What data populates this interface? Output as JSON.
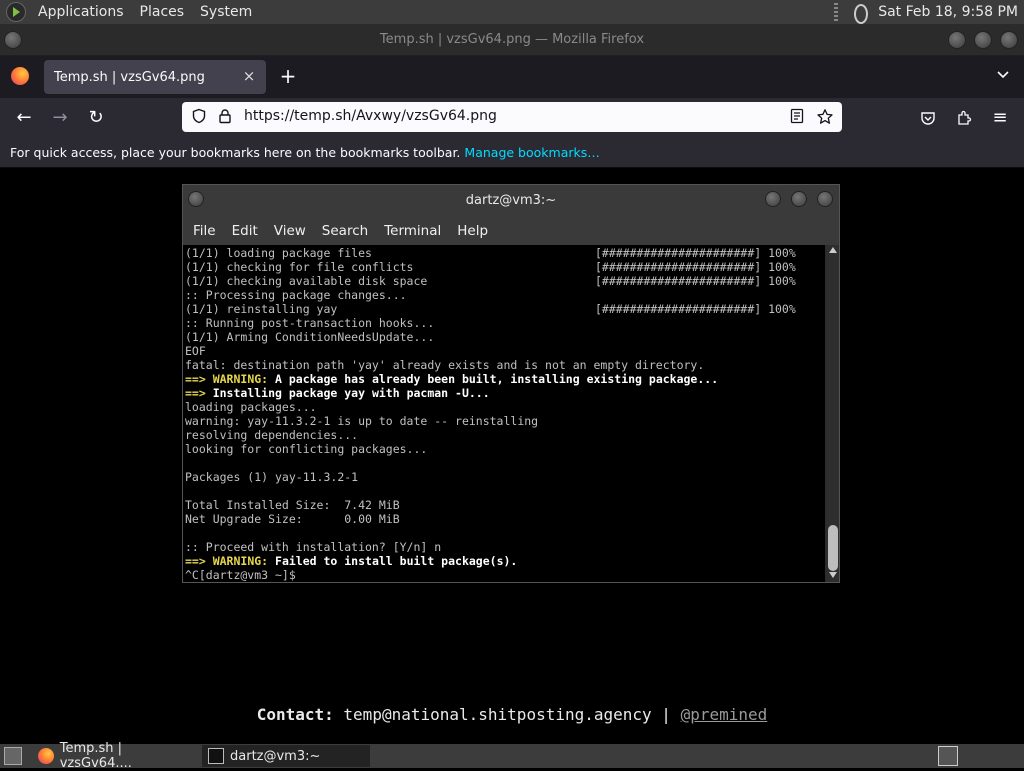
{
  "top_panel": {
    "menus": [
      "Applications",
      "Places",
      "System"
    ],
    "clock": "Sat Feb 18,  9:58 PM"
  },
  "firefox": {
    "window_title": "Temp.sh | vzsGv64.png — Mozilla Firefox",
    "tab_title": "Temp.sh | vzsGv64.png",
    "url": "https://temp.sh/Avxwy/vzsGv64.png",
    "bookmarks_prompt": "For quick access, place your bookmarks here on the bookmarks toolbar.",
    "manage_bookmarks": "Manage bookmarks…"
  },
  "terminal": {
    "title": "dartz@vm3:~",
    "menu": [
      "File",
      "Edit",
      "View",
      "Search",
      "Terminal",
      "Help"
    ],
    "lines": [
      {
        "text": "(1/1) loading package files",
        "progress": "[######################] 100%"
      },
      {
        "text": "(1/1) checking for file conflicts",
        "progress": "[######################] 100%"
      },
      {
        "text": "(1/1) checking available disk space",
        "progress": "[######################] 100%"
      },
      {
        "text": ":: Processing package changes..."
      },
      {
        "text": "(1/1) reinstalling yay",
        "progress": "[######################] 100%"
      },
      {
        "text": ":: Running post-transaction hooks..."
      },
      {
        "text": "(1/1) Arming ConditionNeedsUpdate..."
      },
      {
        "text": "EOF"
      },
      {
        "text": "fatal: destination path 'yay' already exists and is not an empty directory."
      },
      {
        "arrow": "==> ",
        "warn": "WARNING:",
        "bold": " A package has already been built, installing existing package..."
      },
      {
        "arrow": "==> ",
        "bold": "Installing package yay with pacman -U..."
      },
      {
        "text": "loading packages..."
      },
      {
        "text": "warning: yay-11.3.2-1 is up to date -- reinstalling"
      },
      {
        "text": "resolving dependencies..."
      },
      {
        "text": "looking for conflicting packages..."
      },
      {
        "text": ""
      },
      {
        "text": "Packages (1) yay-11.3.2-1"
      },
      {
        "text": ""
      },
      {
        "text": "Total Installed Size:  7.42 MiB"
      },
      {
        "text": "Net Upgrade Size:      0.00 MiB"
      },
      {
        "text": ""
      },
      {
        "text": ":: Proceed with installation? [Y/n] n"
      },
      {
        "arrow": "==> ",
        "warn": "WARNING:",
        "bold": " Failed to install built package(s)."
      },
      {
        "text": "^C[dartz@vm3 ~]$"
      }
    ]
  },
  "contact": {
    "label": "Contact:",
    "email": " temp@national.shitposting.agency | ",
    "handle": "@premined"
  },
  "taskbar": {
    "firefox_task": "Temp.sh | vzsGv64....",
    "terminal_task": "dartz@vm3:~"
  },
  "icons": {
    "back": "←",
    "forward": "→",
    "reload": "↻",
    "close": "×",
    "new_tab": "+",
    "tab_list": "⌄",
    "lock": "🔒",
    "shield": "⛉",
    "star": "☆",
    "menu": "≡",
    "reader": "▤",
    "pocket": "♡",
    "extensions": "⧉"
  }
}
